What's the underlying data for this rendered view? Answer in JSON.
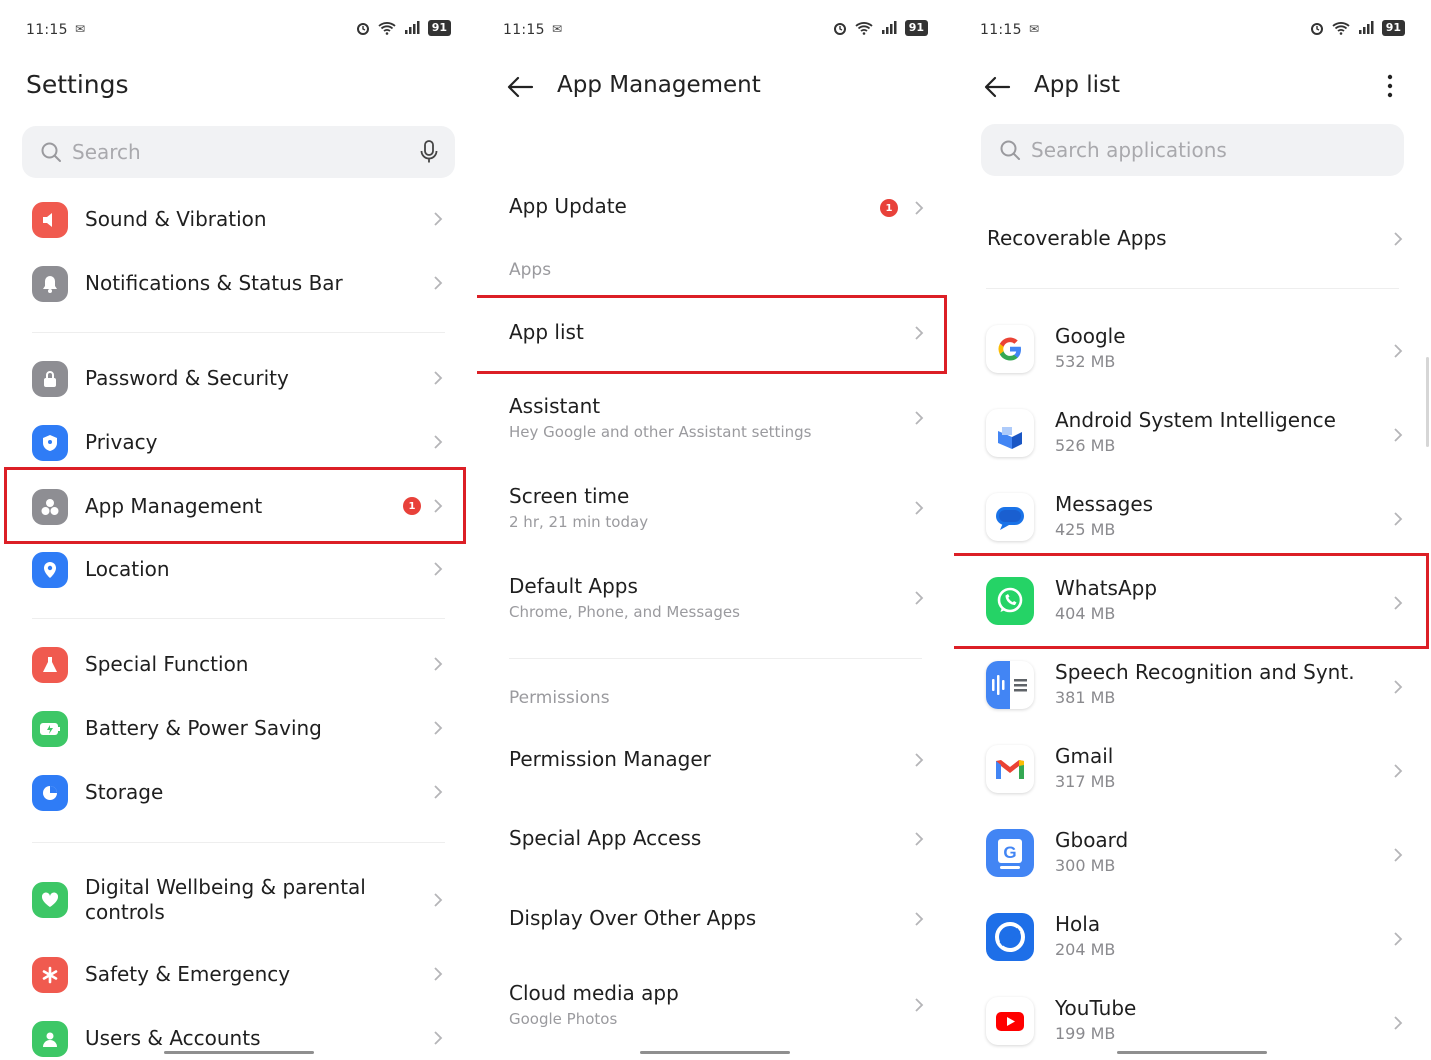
{
  "status_bar": {
    "time": "11:15",
    "battery": "91"
  },
  "colors": {
    "highlight": "#dc1f26",
    "badge": "#e8413a"
  },
  "settings": {
    "title": "Settings",
    "search_placeholder": "Search",
    "items": [
      {
        "label": "Sound & Vibration",
        "icon": "speaker-icon",
        "color": "#f05a4f"
      },
      {
        "label": "Notifications & Status Bar",
        "icon": "bell-icon",
        "color": "#8e8e93"
      },
      {
        "label": "Password & Security",
        "icon": "lock-icon",
        "color": "#8e8e93"
      },
      {
        "label": "Privacy",
        "icon": "shield-icon",
        "color": "#2f7cf6"
      },
      {
        "label": "App Management",
        "icon": "apps-icon",
        "color": "#8e8e93",
        "badge": "1"
      },
      {
        "label": "Location",
        "icon": "location-pin-icon",
        "color": "#2f7cf6"
      },
      {
        "label": "Special Function",
        "icon": "flask-icon",
        "color": "#f05a4f"
      },
      {
        "label": "Battery & Power Saving",
        "icon": "battery-icon",
        "color": "#3dc766"
      },
      {
        "label": "Storage",
        "icon": "pie-chart-icon",
        "color": "#2f7cf6"
      },
      {
        "label": "Digital Wellbeing & parental controls",
        "icon": "heart-icon",
        "color": "#3dc766"
      },
      {
        "label": "Safety & Emergency",
        "icon": "asterisk-icon",
        "color": "#f05a4f"
      },
      {
        "label": "Users & Accounts",
        "icon": "user-icon",
        "color": "#3dc766"
      }
    ]
  },
  "app_management": {
    "title": "App Management",
    "app_update": {
      "label": "App Update",
      "badge": "1"
    },
    "section_apps": "Apps",
    "app_list": {
      "label": "App list"
    },
    "assistant": {
      "label": "Assistant",
      "sub": "Hey Google and other Assistant settings"
    },
    "screen_time": {
      "label": "Screen time",
      "sub": "2 hr, 21 min today"
    },
    "default_apps": {
      "label": "Default Apps",
      "sub": "Chrome, Phone, and Messages"
    },
    "section_permissions": "Permissions",
    "permission_manager": {
      "label": "Permission Manager"
    },
    "special_app_access": {
      "label": "Special App Access"
    },
    "display_over_other_apps": {
      "label": "Display Over Other Apps"
    },
    "cloud_media_app": {
      "label": "Cloud media app",
      "sub": "Google Photos"
    }
  },
  "app_list": {
    "title": "App list",
    "search_placeholder": "Search applications",
    "recoverable": "Recoverable Apps",
    "apps": [
      {
        "name": "Google",
        "size": "532 MB",
        "icon": "google-icon"
      },
      {
        "name": "Android System Intelligence",
        "size": "526 MB",
        "icon": "android-system-intelligence-icon"
      },
      {
        "name": "Messages",
        "size": "425 MB",
        "icon": "messages-icon"
      },
      {
        "name": "WhatsApp",
        "size": "404 MB",
        "icon": "whatsapp-icon"
      },
      {
        "name": "Speech Recognition and Synt.",
        "size": "381 MB",
        "icon": "speech-recognition-icon"
      },
      {
        "name": "Gmail",
        "size": "317 MB",
        "icon": "gmail-icon"
      },
      {
        "name": "Gboard",
        "size": "300 MB",
        "icon": "gboard-icon"
      },
      {
        "name": "Hola",
        "size": "204 MB",
        "icon": "hola-icon"
      },
      {
        "name": "YouTube",
        "size": "199 MB",
        "icon": "youtube-icon"
      }
    ]
  }
}
